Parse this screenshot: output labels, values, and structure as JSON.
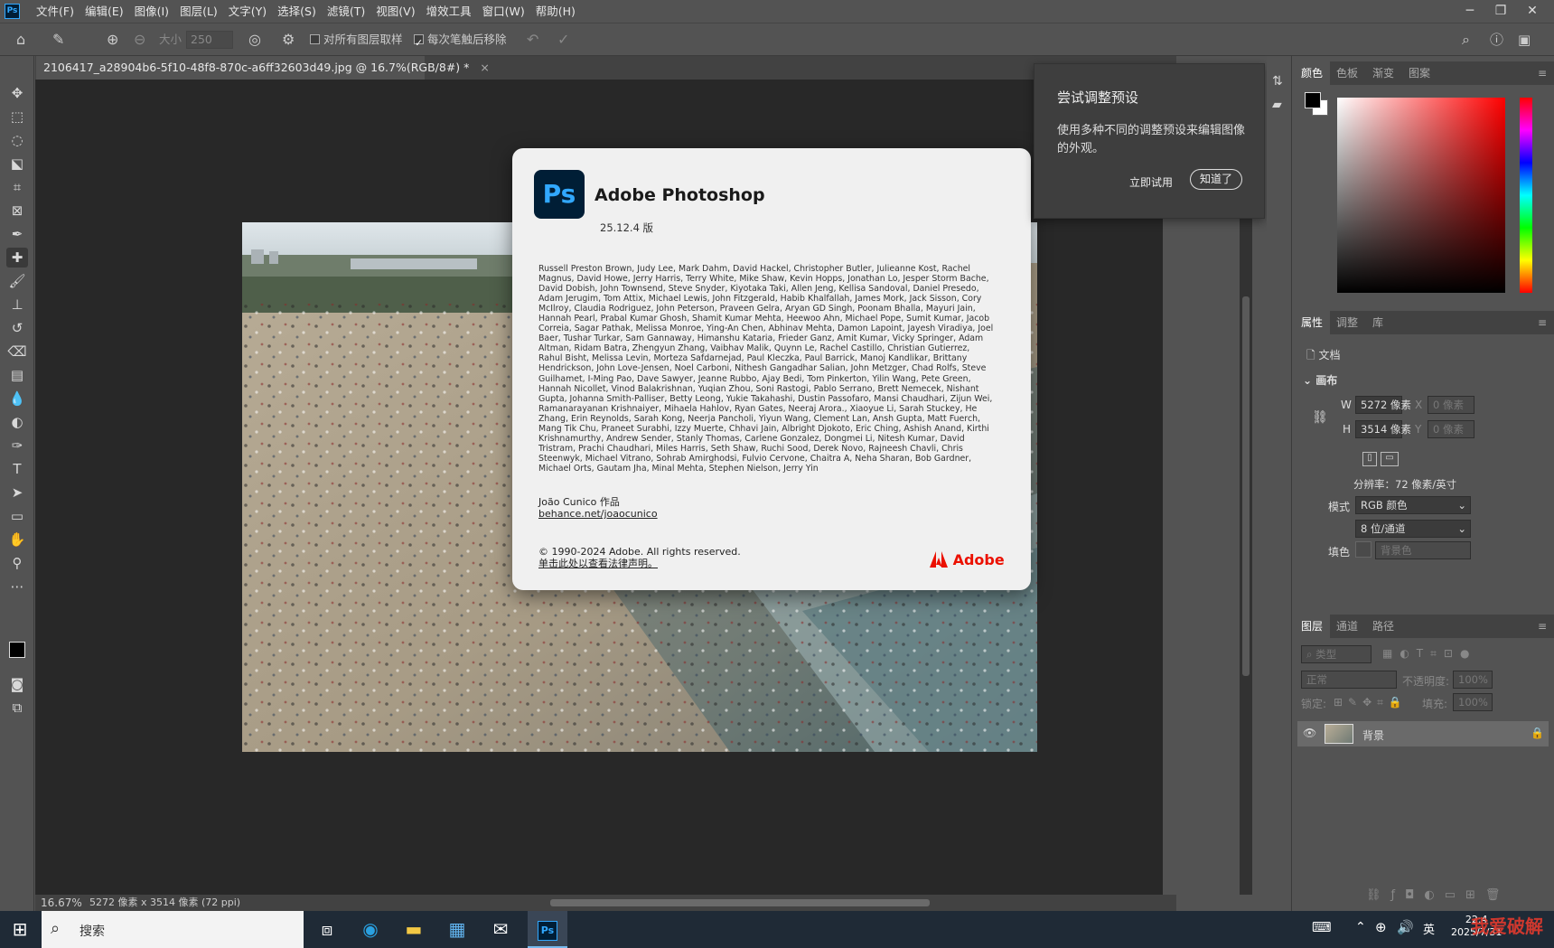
{
  "app": {
    "logo": "Ps"
  },
  "menu": [
    "文件(F)",
    "编辑(E)",
    "图像(I)",
    "图层(L)",
    "文字(Y)",
    "选择(S)",
    "滤镜(T)",
    "视图(V)",
    "增效工具",
    "窗口(W)",
    "帮助(H)"
  ],
  "window_controls": {
    "minimize": "─",
    "restore": "❐",
    "close": "✕"
  },
  "options": {
    "size_label": "大小",
    "size_value": "250",
    "sample_all_layers": "对所有图层取样",
    "remove_after_stroke": "每次笔触后移除"
  },
  "document": {
    "tab_title": "2106417_a28904b6-5f10-48f8-870c-a6ff32603d49.jpg @ 16.7%(RGB/8#) *",
    "close": "×"
  },
  "status": {
    "zoom": "16.67%",
    "info": "5272 像素 x 3514 像素 (72 ppi)"
  },
  "about_dialog": {
    "logo": "Ps",
    "title": "Adobe Photoshop",
    "version": "25.12.4 版",
    "credits": "Russell Preston Brown, Judy Lee, Mark Dahm, David Hackel, Christopher Butler, Julieanne Kost, Rachel Magnus, David Howe, Jerry Harris, Terry White, Mike Shaw, Kevin Hopps, Jonathan Lo, Jesper Storm Bache, David Dobish, John Townsend, Steve Snyder, Kiyotaka Taki, Allen Jeng, Kellisa Sandoval, Daniel Presedo, Adam Jerugim, Tom Attix, Michael Lewis, John Fitzgerald, Habib Khalfallah, James Mork, Jack Sisson, Cory McIlroy, Claudia Rodriguez, John Peterson, Praveen Gelra, Aryan GD Singh, Poonam Bhalla, Mayuri Jain, Hannah Pearl, Prabal Kumar Ghosh, Shamit Kumar Mehta, Heewoo Ahn, Michael Pope, Sumit Kumar, Jacob Correia, Sagar Pathak, Melissa Monroe, Ying-An Chen, Abhinav Mehta, Damon Lapoint, Jayesh Viradiya, Joel Baer, Tushar Turkar, Sam Gannaway, Himanshu Kataria, Frieder Ganz, Amit Kumar, Vicky Springer, Adam Altman, Ridam Batra, Zhengyun Zhang, Vaibhav Malik, Quynn Le, Rachel Castillo, Christian Gutierrez, Rahul Bisht, Melissa Levin, Morteza Safdarnejad, Paul Kleczka, Paul Barrick, Manoj Kandlikar, Brittany Hendrickson, John Love-Jensen, Noel Carboni, Nithesh Gangadhar Salian, John Metzger, Chad Rolfs, Steve Guilhamet, I-Ming Pao, Dave Sawyer, Jeanne Rubbo, Ajay Bedi, Tom Pinkerton, Yilin Wang, Pete Green, Hannah Nicollet, Vinod Balakrishnan, Yuqian Zhou, Soni Rastogi, Pablo Serrano, Brett Nemecek, Nishant Gupta, Johanna Smith-Palliser, Betty Leong, Yukie Takahashi, Dustin Passofaro, Mansi Chaudhari, Zijun Wei, Ramanarayanan Krishnaiyer, Mihaela Hahlov, Ryan Gates, Neeraj Arora., Xiaoyue Li, Sarah Stuckey, He Zhang, Erin Reynolds, Sarah Kong, Neerja Pancholi, Yiyun Wang, Clement Lan, Ansh Gupta, Matt Fuerch, Mang Tik Chu, Praneet Surabhi, Izzy Muerte, Chhavi Jain, Albright Djokoto, Eric Ching, Ashish Anand, Kirthi Krishnamurthy, Andrew Sender, Stanly Thomas, Carlene Gonzalez, Dongmei Li, Nitesh Kumar, David Tristram, Prachi Chaudhari, Miles Harris, Seth Shaw, Ruchi Sood, Derek Novo, Rajneesh Chavli, Chris Steenwyk, Michael Vitrano, Sohrab Amirghodsi, Fulvio Cervone, Chaitra A, Neha Sharan, Bob Gardner, Michael Orts, Gautam Jha, Minal Mehta, Stephen Nielson, Jerry Yin",
    "artist": "João Cunico 作品",
    "artist_link": "behance.net/joaocunico",
    "copyright": "© 1990-2024 Adobe. All rights reserved.",
    "legal_link": "单击此处以查看法律声明。",
    "adobe": "Adobe"
  },
  "tooltip": {
    "title": "尝试调整预设",
    "body": "使用多种不同的调整预设来编辑图像的外观。",
    "try_now": "立即试用",
    "got_it": "知道了"
  },
  "color_panel": {
    "tabs": [
      "颜色",
      "色板",
      "渐变",
      "图案"
    ]
  },
  "properties": {
    "tabs": [
      "属性",
      "调整",
      "库"
    ],
    "doc_label": "文档",
    "canvas_section": "画布",
    "w_label": "W",
    "w_value": "5272 像素",
    "h_label": "H",
    "h_value": "3514 像素",
    "x_label": "X",
    "x_value": "0 像素",
    "y_label": "Y",
    "y_value": "0 像素",
    "resolution": "分辨率：72 像素/英寸",
    "mode_label": "模式",
    "mode_value": "RGB 颜色",
    "depth_value": "8 位/通道",
    "fill_label": "填色",
    "fill_value": "背景色"
  },
  "layers": {
    "tabs": [
      "图层",
      "通道",
      "路径"
    ],
    "filter": "类型",
    "blend": "正常",
    "opacity_label": "不透明度:",
    "opacity_value": "100%",
    "lock_label": "锁定:",
    "fill_label": "填充:",
    "fill_value": "100%",
    "layer_name": "背景"
  },
  "taskbar": {
    "search": "搜索",
    "ps_logo": "Ps",
    "ime": "英",
    "time": "22:4",
    "date": "2025/7/31",
    "watermark": "我爱破解"
  },
  "colors": {
    "accent": "#31a8ff",
    "ps_bg": "#001e36",
    "adobe_red": "#eb1000"
  }
}
